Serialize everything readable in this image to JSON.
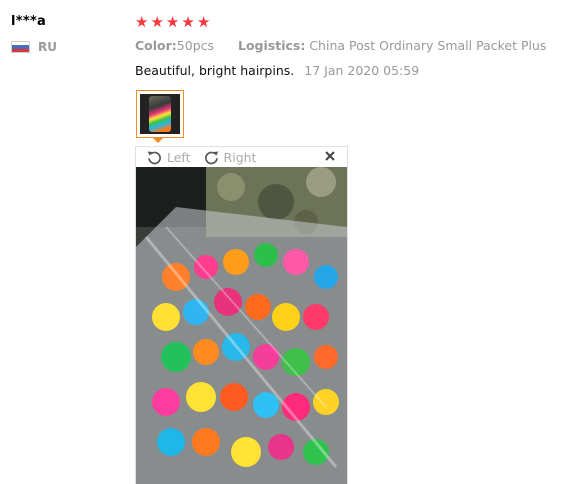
{
  "review": {
    "buyer_name": "l***a",
    "country_code": "RU",
    "rating": 5,
    "star_glyph": "★",
    "color_label": "Color:",
    "color_value": "50pcs",
    "logistics_label": "Logistics:",
    "logistics_value": "China Post Ordinary Small Packet Plus",
    "feedback_text": "Beautiful, bright hairpins.",
    "date": "17 Jan 2020 05:59"
  },
  "viewer": {
    "rotate_left_label": "Left",
    "rotate_right_label": "Right",
    "close_label": "×"
  },
  "colors": {
    "star": "#f5393d",
    "thumb_border": "#f08a24",
    "muted_text": "#999999"
  },
  "icons": {
    "rotate_left": "rotate-left-icon",
    "rotate_right": "rotate-right-icon",
    "close": "close-icon",
    "flag": "russia-flag-icon"
  }
}
